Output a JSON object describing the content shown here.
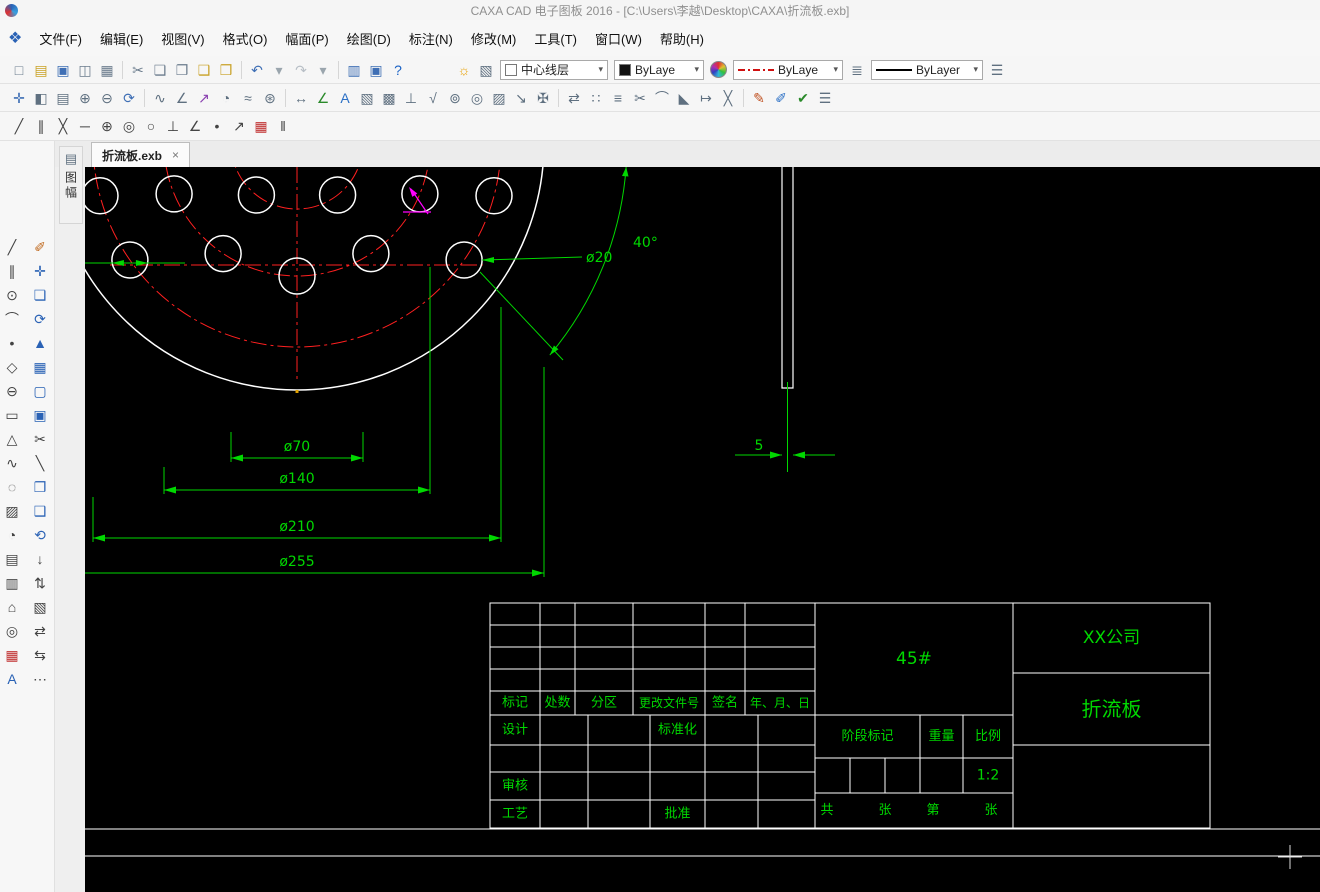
{
  "window": {
    "title": "CAXA CAD 电子图板 2016 - [C:\\Users\\李越\\Desktop\\CAXA\\折流板.exb]"
  },
  "menu": {
    "items": [
      {
        "n": "menu-file",
        "label": "文件(F)"
      },
      {
        "n": "menu-edit",
        "label": "编辑(E)"
      },
      {
        "n": "menu-view",
        "label": "视图(V)"
      },
      {
        "n": "menu-format",
        "label": "格式(O)"
      },
      {
        "n": "menu-paper",
        "label": "幅面(P)"
      },
      {
        "n": "menu-draw",
        "label": "绘图(D)"
      },
      {
        "n": "menu-dimension",
        "label": "标注(N)"
      },
      {
        "n": "menu-modify",
        "label": "修改(M)"
      },
      {
        "n": "menu-tools",
        "label": "工具(T)"
      },
      {
        "n": "menu-window",
        "label": "窗口(W)"
      },
      {
        "n": "menu-help",
        "label": "帮助(H)"
      }
    ]
  },
  "toolbars": {
    "caret": "▾",
    "file_group": [
      {
        "n": "new-file-icon",
        "g": "□",
        "c": "#6b7c8d"
      },
      {
        "n": "open-file-icon",
        "g": "▤",
        "c": "#c9a227"
      },
      {
        "n": "save-icon",
        "g": "▣",
        "c": "#3f6fb5"
      },
      {
        "n": "print-preview-icon",
        "g": "◫",
        "c": "#6b7c8d"
      },
      {
        "n": "print-icon",
        "g": "▦",
        "c": "#6b7c8d"
      }
    ],
    "clipboard_group": [
      {
        "n": "cut-icon",
        "g": "✂",
        "c": "#6b7c8d"
      },
      {
        "n": "copy-icon",
        "g": "❏",
        "c": "#6b7c8d"
      },
      {
        "n": "copy-basepoint-icon",
        "g": "❐",
        "c": "#6b7c8d"
      },
      {
        "n": "paste-icon",
        "g": "❑",
        "c": "#c9a227"
      },
      {
        "n": "paste-special-icon",
        "g": "❒",
        "c": "#c9a227"
      }
    ],
    "undo_group": [
      {
        "n": "undo-icon",
        "g": "↶",
        "c": "#3f6fb5"
      },
      {
        "n": "undo-dropdown-icon",
        "g": "▾",
        "c": "#9aa5ad"
      },
      {
        "n": "redo-icon",
        "g": "↷",
        "c": "#b8bfc6"
      },
      {
        "n": "redo-dropdown-icon",
        "g": "▾",
        "c": "#9aa5ad"
      }
    ],
    "module_group": [
      {
        "n": "paper-frame-icon",
        "g": "▥",
        "c": "#3f6fb5"
      },
      {
        "n": "library-icon",
        "g": "▣",
        "c": "#3f6fb5"
      },
      {
        "n": "help-icon",
        "g": "?",
        "c": "#1a62c5"
      }
    ],
    "layer_bulb_glyph": "☼",
    "layer_props_glyph": "▧",
    "layer_combo_value": "中心线层",
    "color_combo_value": "ByLaye",
    "linetype_combo_value": "ByLaye",
    "lineweight_combo_value": "ByLayer",
    "linetype_btn_glyph": "≣",
    "lineweight_btn_glyph": "☰",
    "view_group": [
      {
        "n": "pan-icon",
        "g": "✛",
        "c": "#3f6fb5"
      },
      {
        "n": "zoom-window-icon",
        "g": "◧",
        "c": "#5f7080"
      },
      {
        "n": "zoom-all-icon",
        "g": "▤",
        "c": "#5f7080"
      },
      {
        "n": "zoom-in-icon",
        "g": "⊕",
        "c": "#5f7080"
      },
      {
        "n": "zoom-out-icon",
        "g": "⊖",
        "c": "#5f7080"
      },
      {
        "n": "redraw-icon",
        "g": "⟳",
        "c": "#3f6fb5"
      }
    ],
    "draw_group": [
      {
        "n": "spline-icon",
        "g": "∿",
        "c": "#5f7080"
      },
      {
        "n": "polyline-icon",
        "g": "∠",
        "c": "#5f7080"
      },
      {
        "n": "leader-arrow-icon",
        "g": "↗",
        "c": "#8a40b0"
      },
      {
        "n": "arc-3pt-icon",
        "g": "◔",
        "c": "#5f7080"
      },
      {
        "n": "curve-icon",
        "g": "≈",
        "c": "#5f7080"
      },
      {
        "n": "node-edit-icon",
        "g": "⊛",
        "c": "#5f7080"
      }
    ],
    "annotate_group": [
      {
        "n": "dim-linear-icon",
        "g": "↔",
        "c": "#5f7080"
      },
      {
        "n": "dim-angular-icon",
        "g": "∠",
        "c": "#2a8a2a"
      },
      {
        "n": "text-tool-icon",
        "g": "A",
        "c": "#2a6fc5"
      },
      {
        "n": "image-icon",
        "g": "▧",
        "c": "#5f7080"
      },
      {
        "n": "region-icon",
        "g": "▩",
        "c": "#5f7080"
      },
      {
        "n": "datum-icon",
        "g": "⊥",
        "c": "#5f7080"
      },
      {
        "n": "roughness-icon",
        "g": "√",
        "c": "#5f7080"
      },
      {
        "n": "balloon-icon",
        "g": "⊚",
        "c": "#5f7080"
      },
      {
        "n": "center-mark-icon",
        "g": "◎",
        "c": "#5f7080"
      },
      {
        "n": "hatch-icon",
        "g": "▨",
        "c": "#5f7080"
      },
      {
        "n": "leader-icon",
        "g": "↘",
        "c": "#5f7080"
      },
      {
        "n": "symbol-icon",
        "g": "✠",
        "c": "#5f7080"
      }
    ],
    "modify_group": [
      {
        "n": "mirror-icon",
        "g": "⇄",
        "c": "#5f7080"
      },
      {
        "n": "array-icon",
        "g": "∷",
        "c": "#5f7080"
      },
      {
        "n": "offset-icon",
        "g": "≡",
        "c": "#5f7080"
      },
      {
        "n": "trim-icon",
        "g": "✂",
        "c": "#5f7080"
      },
      {
        "n": "fillet-icon",
        "g": "⌒",
        "c": "#5f7080"
      },
      {
        "n": "chamfer-icon",
        "g": "◣",
        "c": "#5f7080"
      },
      {
        "n": "stretch-icon",
        "g": "↦",
        "c": "#5f7080"
      },
      {
        "n": "break-icon",
        "g": "╳",
        "c": "#5f7080"
      }
    ],
    "format_group": [
      {
        "n": "format-brush-icon",
        "g": "✎",
        "c": "#c05020"
      },
      {
        "n": "match-prop-icon",
        "g": "✐",
        "c": "#2a6fc5"
      },
      {
        "n": "verify-icon",
        "g": "✔",
        "c": "#2a8a2a"
      },
      {
        "n": "list-options-icon",
        "g": "☰",
        "c": "#5f7080"
      }
    ],
    "sketch_group": [
      {
        "n": "line-tool-icon",
        "g": "╱",
        "c": "#444444"
      },
      {
        "n": "parallel-tool-icon",
        "g": "∥",
        "c": "#444444"
      },
      {
        "n": "intersect-tool-icon",
        "g": "╳",
        "c": "#444444"
      },
      {
        "n": "segment-tool-icon",
        "g": "─",
        "c": "#444444"
      },
      {
        "n": "circle-center-icon",
        "g": "⊕",
        "c": "#444444"
      },
      {
        "n": "concentric-circle-icon",
        "g": "◎",
        "c": "#444444"
      },
      {
        "n": "tangent-circle-icon",
        "g": "○",
        "c": "#444444"
      },
      {
        "n": "perpendicular-icon",
        "g": "⊥",
        "c": "#444444"
      },
      {
        "n": "angle-line-icon",
        "g": "∠",
        "c": "#444444"
      },
      {
        "n": "point-tool-icon",
        "g": "•",
        "c": "#444444"
      },
      {
        "n": "vector-tool-icon",
        "g": "↗",
        "c": "#444444"
      },
      {
        "n": "grid-red-icon",
        "g": "▦",
        "c": "#c03030"
      },
      {
        "n": "column-tool-icon",
        "g": "‖",
        "c": "#444444"
      }
    ],
    "palette": [
      {
        "n": "line-tool-icon",
        "g": "╱",
        "c": "#444444"
      },
      {
        "n": "sketch-pencil-icon",
        "g": "✐",
        "c": "#c06a20"
      },
      {
        "n": "parallel-line-icon",
        "g": "∥",
        "c": "#444444"
      },
      {
        "n": "move-tool-icon",
        "g": "✛",
        "c": "#2a62b5"
      },
      {
        "n": "circle-tool-icon",
        "g": "⊙",
        "c": "#444444"
      },
      {
        "n": "link-tool-icon",
        "g": "❏",
        "c": "#2a62b5"
      },
      {
        "n": "arc-tool-icon",
        "g": "⌒",
        "c": "#444444"
      },
      {
        "n": "rotate-tool-icon",
        "g": "⟳",
        "c": "#2a62b5"
      },
      {
        "n": "point-tool-icon",
        "g": "•",
        "c": "#444444"
      },
      {
        "n": "fill-tool-icon",
        "g": "▲",
        "c": "#2a62b5"
      },
      {
        "n": "polygon-tool-icon",
        "g": "◇",
        "c": "#444444"
      },
      {
        "n": "grid-block-icon",
        "g": "▦",
        "c": "#2a62b5"
      },
      {
        "n": "ellipse-tool-icon",
        "g": "⊖",
        "c": "#444444"
      },
      {
        "n": "frame-tool-icon",
        "g": "▢",
        "c": "#2a62b5"
      },
      {
        "n": "rectangle-tool-icon",
        "g": "▭",
        "c": "#444444"
      },
      {
        "n": "block-save-icon",
        "g": "▣",
        "c": "#2a62b5"
      },
      {
        "n": "triangle-tool-icon",
        "g": "△",
        "c": "#444444"
      },
      {
        "n": "trim-tool-icon",
        "g": "✂",
        "c": "#444444"
      },
      {
        "n": "wave-tool-icon",
        "g": "∿",
        "c": "#444444"
      },
      {
        "n": "break-line-icon",
        "g": "╲",
        "c": "#444444"
      },
      {
        "n": "dashed-circle-icon",
        "g": "◌",
        "c": "#444444"
      },
      {
        "n": "doc-tool-icon",
        "g": "❐",
        "c": "#2a62b5"
      },
      {
        "n": "hatch-tool-icon",
        "g": "▨",
        "c": "#444444"
      },
      {
        "n": "copy-entity-icon",
        "g": "❑",
        "c": "#2a62b5"
      },
      {
        "n": "contour-tool-icon",
        "g": "◔",
        "c": "#444444"
      },
      {
        "n": "refresh-tool-icon",
        "g": "⟲",
        "c": "#2a62b5"
      },
      {
        "n": "grid-tool-icon",
        "g": "▤",
        "c": "#444444"
      },
      {
        "n": "down-tool-icon",
        "g": "↓",
        "c": "#444444"
      },
      {
        "n": "sheet-tool-icon",
        "g": "▥",
        "c": "#444444"
      },
      {
        "n": "sort-tool-icon",
        "g": "⇅",
        "c": "#444444"
      },
      {
        "n": "home-tool-icon",
        "g": "⌂",
        "c": "#444444"
      },
      {
        "n": "panel-tool-icon",
        "g": "▧",
        "c": "#444444"
      },
      {
        "n": "target-tool-icon",
        "g": "◎",
        "c": "#444444"
      },
      {
        "n": "swap-tool-icon",
        "g": "⇄",
        "c": "#444444"
      },
      {
        "n": "red-grid-icon",
        "g": "▦",
        "c": "#c03030"
      },
      {
        "n": "shift-tool-icon",
        "g": "⇆",
        "c": "#444444"
      },
      {
        "n": "text-tool-icon",
        "g": "A",
        "c": "#2a62b5"
      },
      {
        "n": "more-tool-icon",
        "g": "⋯",
        "c": "#444444"
      }
    ]
  },
  "side_tab": {
    "icon": "▤",
    "label": "图幅"
  },
  "document_tab": {
    "label": "折流板.exb",
    "close": "×"
  },
  "drawing": {
    "dims": {
      "d70": "ø70",
      "d140": "ø140",
      "d210": "ø210",
      "d255": "ø255",
      "d20": "ø20",
      "angle": "40°",
      "thickness": "5"
    },
    "title_block": {
      "cols": [
        "标记",
        "处数",
        "分区",
        "更改文件号",
        "签名",
        "年、月、日"
      ],
      "design": "设计",
      "standard": "标准化",
      "audit": "审核",
      "process": "工艺",
      "approve": "批准",
      "material": "45#",
      "stage": "阶段标记",
      "weight": "重量",
      "scale_label": "比例",
      "scale": "1:2",
      "total": "共",
      "sheet1": "张",
      "no": "第",
      "sheet2": "张",
      "company": "XX公司",
      "part": "折流板"
    }
  }
}
